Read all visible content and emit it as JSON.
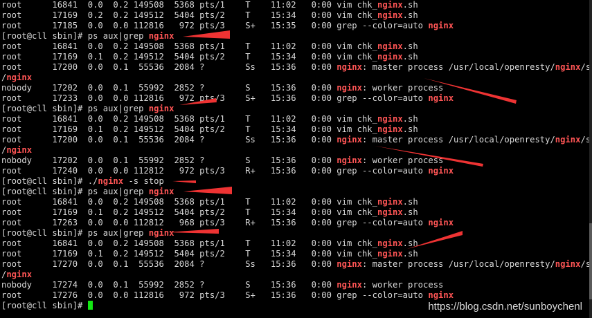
{
  "terminal": {
    "lines": [
      "root      16841  0.0  0.2 149508  5368 pts/1    T    11:02   0:00 vim chk_nginx.sh",
      "root      17169  0.2  0.2 149512  5404 pts/2    T    15:34   0:00 vim chk_nginx.sh",
      "root      17185  0.0  0.0 112816   972 pts/3    S+   15:35   0:00 grep --color=auto nginx",
      "[root@cll sbin]# ps aux|grep nginx",
      "root      16841  0.0  0.2 149508  5368 pts/1    T    11:02   0:00 vim chk_nginx.sh",
      "root      17169  0.1  0.2 149512  5404 pts/2    T    15:34   0:00 vim chk_nginx.sh",
      "root      17200  0.0  0.1  55536  2084 ?        Ss   15:36   0:00 nginx: master process /usr/local/openresty/nginx/sbin",
      "/nginx",
      "nobody    17202  0.0  0.1  55992  2852 ?        S    15:36   0:00 nginx: worker process",
      "root      17233  0.0  0.0 112816   972 pts/3    S+   15:36   0:00 grep --color=auto nginx",
      "[root@cll sbin]# ps aux|grep nginx",
      "root      16841  0.0  0.2 149508  5368 pts/1    T    11:02   0:00 vim chk_nginx.sh",
      "root      17169  0.1  0.2 149512  5404 pts/2    T    15:34   0:00 vim chk_nginx.sh",
      "root      17200  0.0  0.1  55536  2084 ?        Ss   15:36   0:00 nginx: master process /usr/local/openresty/nginx/sbin",
      "/nginx",
      "nobody    17202  0.0  0.1  55992  2852 ?        S    15:36   0:00 nginx: worker process",
      "root      17240  0.0  0.0 112812   972 pts/3    R+   15:36   0:00 grep --color=auto nginx",
      "[root@cll sbin]# ./nginx -s stop",
      "[root@cll sbin]# ps aux|grep nginx",
      "root      16841  0.0  0.2 149508  5368 pts/1    T    11:02   0:00 vim chk_nginx.sh",
      "root      17169  0.1  0.2 149512  5404 pts/2    T    15:34   0:00 vim chk_nginx.sh",
      "root      17263  0.0  0.0 112812   968 pts/3    R+   15:36   0:00 grep --color=auto nginx",
      "[root@cll sbin]# ps aux|grep nginx",
      "root      16841  0.0  0.2 149508  5368 pts/1    T    11:02   0:00 vim chk_nginx.sh",
      "root      17169  0.1  0.2 149512  5404 pts/2    T    15:34   0:00 vim chk_nginx.sh",
      "root      17270  0.0  0.1  55536  2084 ?        Ss   15:36   0:00 nginx: master process /usr/local/openresty/nginx/sbin",
      "/nginx",
      "nobody    17274  0.0  0.1  55992  2852 ?        S    15:36   0:00 nginx: worker process",
      "root      17276  0.0  0.0 112816   972 pts/3    S+   15:36   0:00 grep --color=auto nginx",
      "[root@cll sbin]# "
    ],
    "highlight_word": "nginx",
    "colors": {
      "background": "#000000",
      "text": "#d9d9d9",
      "highlight": "#ff5555",
      "cursor": "#13e813",
      "arrow": "#ee3333"
    }
  },
  "watermark": "https://blog.csdn.net/sunboychenl"
}
